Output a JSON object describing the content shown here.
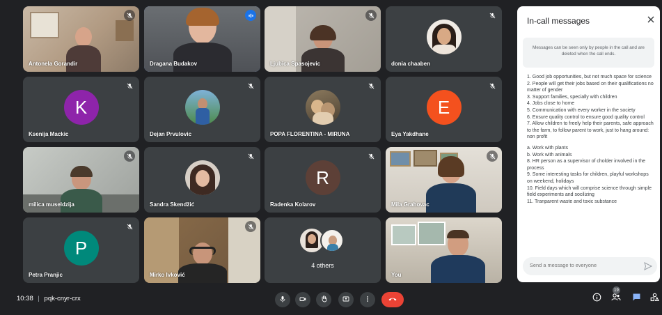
{
  "meeting": {
    "time": "10:38",
    "separator": "|",
    "code": "pqk-cnyr-crx",
    "people_badge": "19"
  },
  "participants": [
    {
      "name": "Antonela Gorandir",
      "type": "video",
      "muted": true
    },
    {
      "name": "Dragana Budakov",
      "type": "video",
      "speaking": true
    },
    {
      "name": "Ljubica Spasojevic",
      "type": "video",
      "muted": true
    },
    {
      "name": "donia chaaben",
      "type": "photo",
      "muted": true
    },
    {
      "name": "Ksenija Mackic",
      "type": "initial",
      "initial": "K",
      "color": "#8e24aa",
      "muted": true
    },
    {
      "name": "Dejan Prvulovic",
      "type": "photo",
      "muted": true
    },
    {
      "name": "POPA FLORENTINA - MIRUNA",
      "type": "photo",
      "muted": true
    },
    {
      "name": "Eya Yakdhane",
      "type": "initial",
      "initial": "E",
      "color": "#f4511e",
      "muted": true
    },
    {
      "name": "milica museldzija",
      "type": "video",
      "muted": true
    },
    {
      "name": "Sandra Skendžić",
      "type": "photo",
      "muted": true
    },
    {
      "name": "Radenka Kolarov",
      "type": "initial",
      "initial": "R",
      "color": "#5d4037",
      "muted": true
    },
    {
      "name": "Mila Grahovac",
      "type": "video",
      "muted": true
    },
    {
      "name": "Petra Pranjic",
      "type": "initial",
      "initial": "P",
      "color": "#00897b",
      "muted": true
    },
    {
      "name": "Mirko Ivković",
      "type": "video",
      "muted": true
    },
    {
      "name": "4 others",
      "type": "others"
    },
    {
      "name": "You",
      "type": "video"
    }
  ],
  "chat": {
    "title": "In-call messages",
    "notice": "Messages can be seen only by people in the call and are deleted when the call ends.",
    "messages": [
      "1.    Good job opportunities, but not much space for science",
      "2.    People will get their jobs based on their qualifications no matter of gender",
      "3.    Support families, specially with children",
      "4.    Jobs close to home",
      "5.    Communication with every worker in the society",
      "6.    Ensure quality control to ensure good quality control",
      "7.    Allow children to freely help their parents, safe approach to the farm, to follow parent to work, just to hang around: non profit",
      "",
      "a.    Work with plants",
      "b.    Work with animals",
      "8.    HR person as a supervisor of cholder involved in the process",
      "9.    Some interesting tasks for children, playful workshops on weekend, holidays",
      "10.  Field days which will comprise science through simple field experiments and socilizing",
      "11.  Tranparent waste and toxic substance"
    ],
    "input_placeholder": "Send a message to everyone"
  },
  "colors": {
    "background": "#202124",
    "tile": "#3c4043",
    "end_call": "#ea4335",
    "accent": "#8ab4f8"
  },
  "icons": [
    "mic-icon",
    "camera-icon",
    "raise-hand-icon",
    "present-icon",
    "more-options-icon",
    "end-call-icon",
    "info-icon",
    "people-icon",
    "chat-icon",
    "activities-icon",
    "close-icon",
    "send-icon",
    "mic-off-icon",
    "speaking-icon"
  ]
}
